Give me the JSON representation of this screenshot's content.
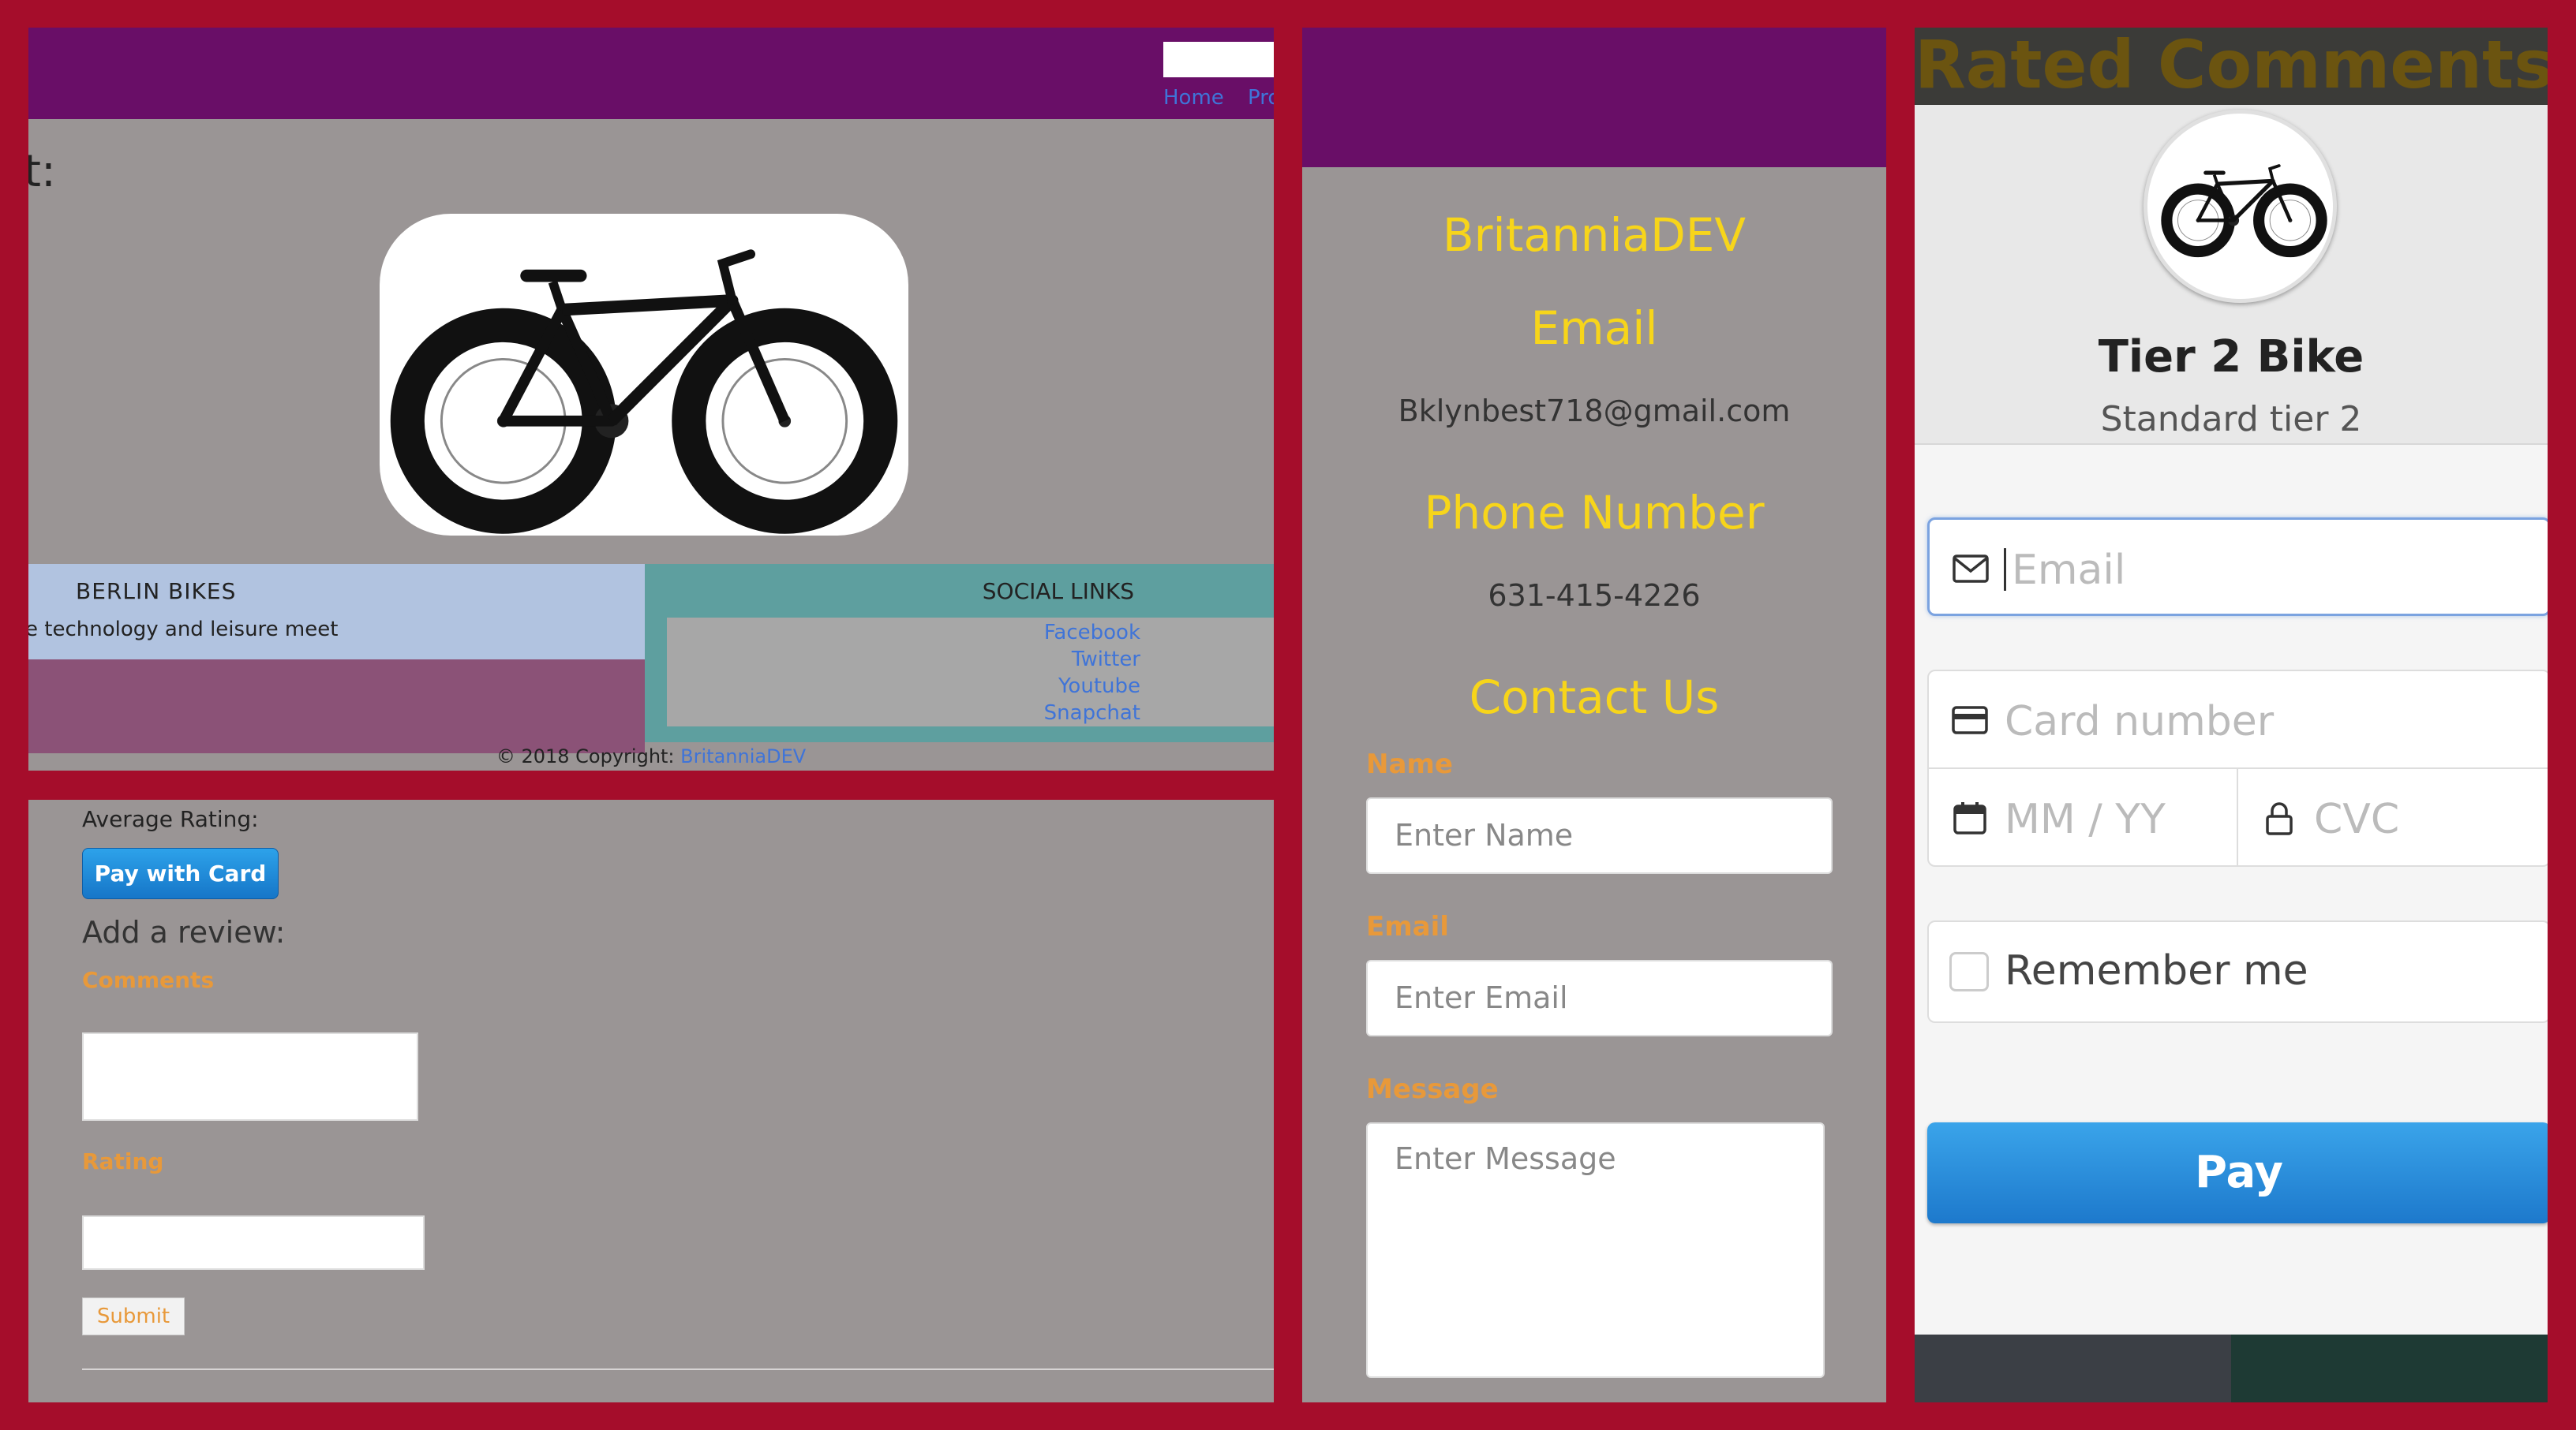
{
  "product_page": {
    "nav_links": [
      "Home",
      "Pro"
    ],
    "heading_fragment": "t:",
    "bike_image": "fat-tire-bicycle",
    "footer": {
      "brand": "BERLIN BIKES",
      "tagline": "e technology and leisure meet",
      "social_title": "SOCIAL LINKS",
      "social_links": [
        "Facebook",
        "Twitter",
        "Youtube",
        "Snapchat"
      ],
      "copyright": "© 2018 Copyright:",
      "copyright_link": "BritanniaDEV"
    }
  },
  "review_form": {
    "average_rating": "Average Rating:",
    "pay_button": "Pay with Card",
    "add_review": "Add a review:",
    "comments_label": "Comments",
    "rating_label": "Rating",
    "submit_label": "Submit"
  },
  "contact": {
    "company": "BritanniaDEV",
    "email_heading": "Email",
    "email": "Bklynbest718@gmail.com",
    "phone_heading": "Phone Number",
    "phone": "631-415-4226",
    "contact_heading": "Contact Us",
    "name_label": "Name",
    "name_placeholder": "Enter Name",
    "email_label": "Email",
    "email_placeholder": "Enter Email",
    "message_label": "Message",
    "message_placeholder": "Enter Message"
  },
  "checkout": {
    "background_heading": "Rated Comments",
    "product_name": "Tier 2 Bike",
    "product_subtitle": "Standard tier 2",
    "email_placeholder": "Email",
    "card_placeholder": "Card number",
    "expiry_placeholder": "MM / YY",
    "cvc_placeholder": "CVC",
    "remember_label": "Remember me",
    "pay_label": "Pay"
  },
  "colors": {
    "border": "#a50d2b",
    "nav_purple": "#690e67",
    "panel_gray": "#9a9595",
    "heading_yellow": "#f7d51a",
    "label_orange": "#e8993a",
    "link_blue": "#3f74d8",
    "stripe_blue": "#1d79cc"
  },
  "icons": [
    "bicycle-image",
    "envelope-icon",
    "credit-card-icon",
    "calendar-icon",
    "lock-icon",
    "checkbox-icon"
  ]
}
